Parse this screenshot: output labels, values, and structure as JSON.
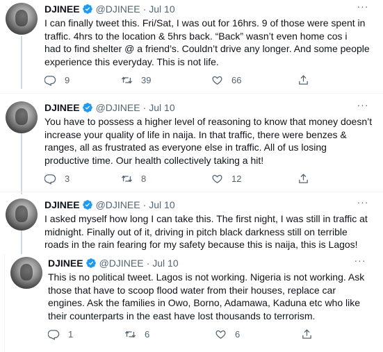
{
  "author": {
    "name": "DJINEE",
    "handle": "@DJINEE",
    "dot": "·",
    "more": "···"
  },
  "icons": {
    "reply": "reply-icon",
    "retweet": "retweet-icon",
    "like": "heart-icon",
    "share": "share-icon",
    "verified": "verified-badge-icon"
  },
  "colors": {
    "verified": "#1d9bf0",
    "muted": "#536471",
    "text": "#0f1419"
  },
  "tweets": [
    {
      "date": "Jul 10",
      "lines": [
        "I can finally tweet this. Fri/Sat, I was out for 16hrs. 9 of those were spent in",
        "traffic. 4hrs to the location & 5hrs back. “Back” wasn’t even home cos i",
        "had to find shelter @ a friend’s. Couldn’t drive any longer. And some people",
        "experience this everyday. This is not life."
      ],
      "replies": "9",
      "retweets": "39",
      "likes": "66"
    },
    {
      "date": "Jul 10",
      "lines": [
        "You have to possess a higher level of reasoning to know that money doesn’t",
        "increase your quality of life in naija. In that traffic, there were benzes &",
        "ranges, all as frustrated as everyone else in traffic. All of us losing",
        "productive time. Our health collectively taking a hit!"
      ],
      "replies": "3",
      "retweets": "8",
      "likes": "12"
    },
    {
      "date": "Jul 10",
      "lines": [
        "I asked myself how long I can take this. The first night, I was still in traffic at",
        "midnight. Finally out of it, driving in pitch black darkness still on terrible",
        "roads in the rain fearing for my safety because this is naija, this is Lagos!"
      ]
    },
    {
      "date": "Jul 10",
      "lines": [
        "This is no political tweet. Lagos is not working. Nigeria is not working. Ask",
        "those that have to scoop flood water from their houses, replace car",
        "engines. Ask the families in Owo, Borno, Adamawa, Kaduna etc who like",
        "their counterparts in the east have lost thousands to terrorism."
      ],
      "replies": "1",
      "retweets": "6",
      "likes": "6"
    }
  ]
}
